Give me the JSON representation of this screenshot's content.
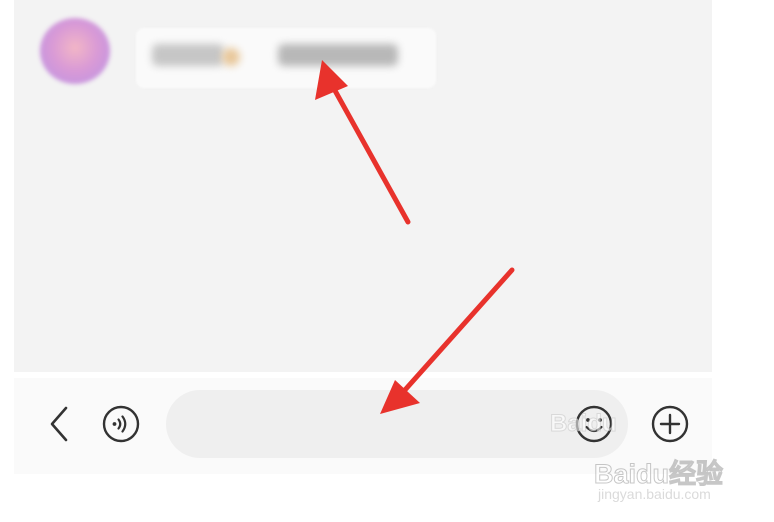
{
  "chat": {
    "message": {
      "sender_name": "",
      "text": ""
    }
  },
  "input_bar": {
    "icons": {
      "back": "chevron-left-icon",
      "voice": "voice-icon",
      "emoji": "emoji-icon",
      "plus": "plus-circle-icon"
    },
    "placeholder": "",
    "value": ""
  },
  "annotations": {
    "arrow_color": "#e8322c"
  },
  "watermark": {
    "brand": "Baidu经验",
    "url": "jingyan.baidu.com",
    "faint_brand": "Baidu"
  }
}
